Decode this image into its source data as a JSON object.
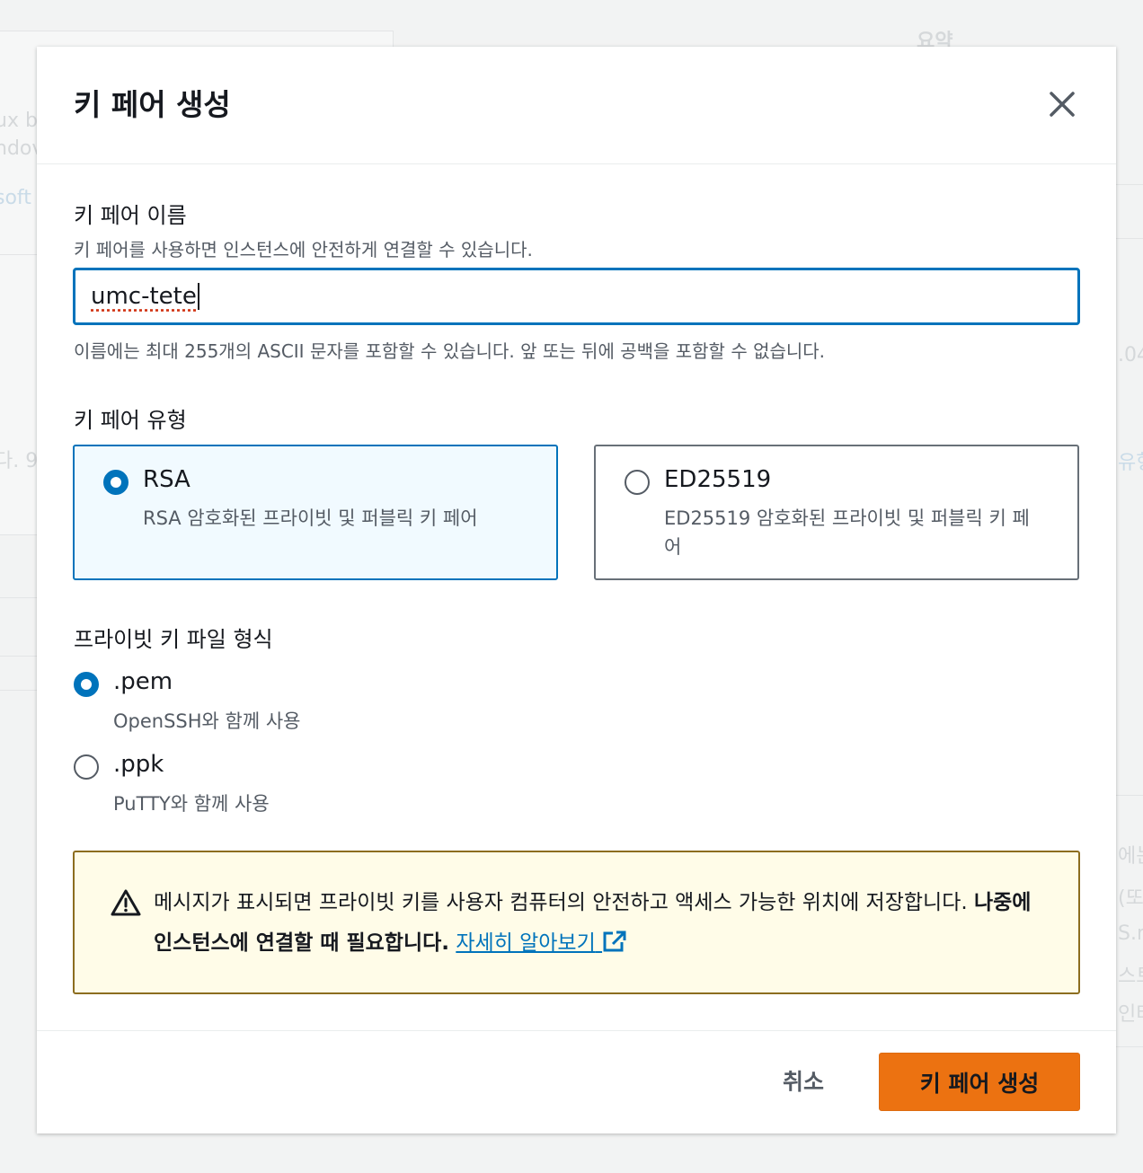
{
  "background": {
    "fragments_left": [
      "ux b",
      "ndov",
      "soft",
      "다. 9"
    ],
    "fragments_right": [
      "요약",
      ".04",
      "유형",
      "에는",
      "(또",
      "S.m",
      "스토",
      "인터"
    ]
  },
  "modal": {
    "title": "키 페어 생성",
    "name_field": {
      "label": "키 페어 이름",
      "description": "키 페어를 사용하면 인스턴스에 안전하게 연결할 수 있습니다.",
      "value": "umc-tete",
      "constraint": "이름에는 최대 255개의 ASCII 문자를 포함할 수 있습니다. 앞 또는 뒤에 공백을 포함할 수 없습니다."
    },
    "key_type": {
      "label": "키 페어 유형",
      "options": [
        {
          "title": "RSA",
          "description": "RSA 암호화된 프라이빗 및 퍼블릭 키 페어",
          "selected": true
        },
        {
          "title": "ED25519",
          "description": "ED25519 암호화된 프라이빗 및 퍼블릭 키 페어",
          "selected": false
        }
      ]
    },
    "file_format": {
      "label": "프라이빗 키 파일 형식",
      "options": [
        {
          "title": ".pem",
          "description": "OpenSSH와 함께 사용",
          "selected": true
        },
        {
          "title": ".ppk",
          "description": "PuTTY와 함께 사용",
          "selected": false
        }
      ]
    },
    "warning": {
      "text": "메시지가 표시되면 프라이빗 키를 사용자 컴퓨터의 안전하고 액세스 가능한 위치에 저장합니다. ",
      "bold_text": "나중에 인스턴스에 연결할 때 필요합니다.",
      "link_text": "자세히 알아보기"
    },
    "footer": {
      "cancel_label": "취소",
      "submit_label": "키 페어 생성"
    }
  },
  "colors": {
    "accent": "#0073bb",
    "primary_button": "#ec7211",
    "warning_bg": "#fffce8",
    "warning_border": "#8c6d1f"
  }
}
